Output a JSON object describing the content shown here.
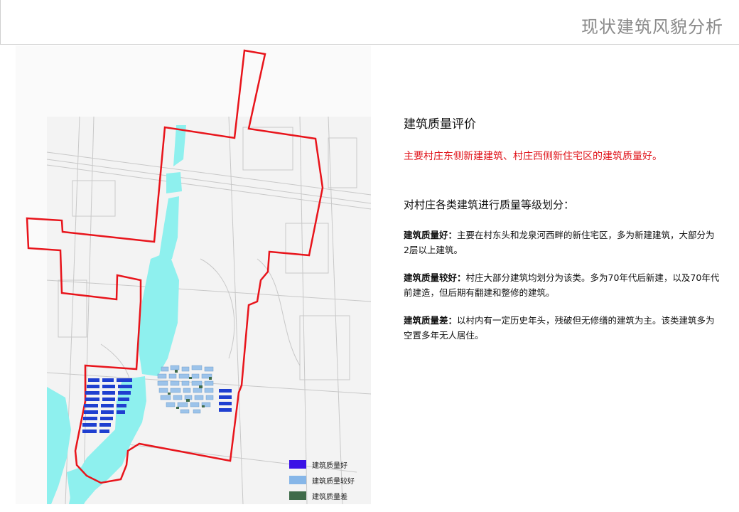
{
  "header": {
    "title": "现状建筑风貌分析"
  },
  "map": {
    "boundary_color": "#e8141b",
    "water_color": "#8ef0ee",
    "legend": [
      {
        "label": "建筑质量好",
        "color": "#3a12e6"
      },
      {
        "label": "建筑质量较好",
        "color": "#86b6e8"
      },
      {
        "label": "建筑质量差",
        "color": "#3f6b4a"
      }
    ]
  },
  "content": {
    "heading": "建筑质量评价",
    "highlight": "主要村庄东侧新建建筑、村庄西侧新住宅区的建筑质量好。",
    "subheading": "对村庄各类建筑进行质量等级划分：",
    "items": [
      {
        "term": "建筑质量好：",
        "text": "主要在村东头和龙泉河西畔的新住宅区，多为新建建筑，大部分为2层以上建筑。"
      },
      {
        "term": "建筑质量较好：",
        "text": "村庄大部分建筑均划分为该类。多为70年代后新建，以及70年代前建造，但后期有翻建和整修的建筑。"
      },
      {
        "term": "建筑质量差：",
        "text": "以村内有一定历史年头，残破但无修缮的建筑为主。该类建筑多为空置多年无人居住。"
      }
    ]
  }
}
